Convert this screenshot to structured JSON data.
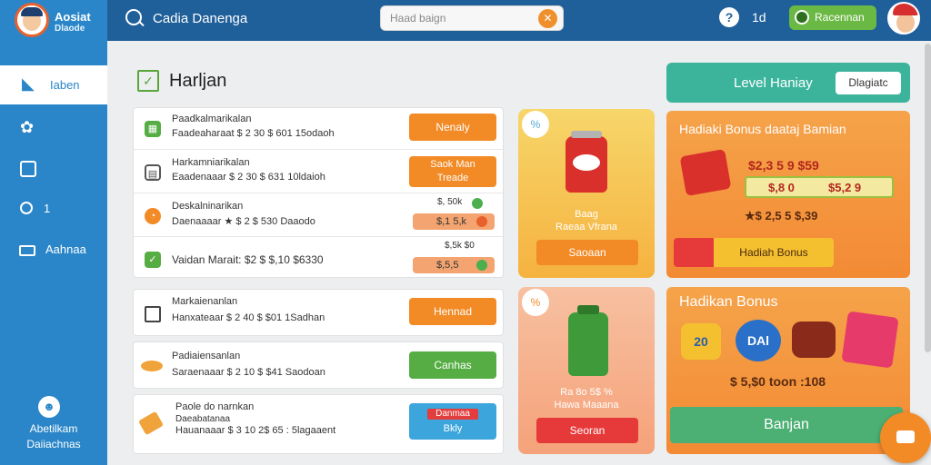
{
  "logo": {
    "line1": "Aosiat",
    "line2": "Dlaode"
  },
  "topbar": {
    "title": "Cadia Danenga",
    "search_placeholder": "Haad baign",
    "help_label": "?",
    "count": "1d",
    "redeem_label": "Racennan"
  },
  "sidebar": {
    "items": [
      {
        "label": "Iaben",
        "icon": "megaphone-icon"
      },
      {
        "label": "",
        "icon": "gear-icon"
      },
      {
        "label": "",
        "icon": "bookmark-icon"
      },
      {
        "label": "1",
        "icon": "search-icon"
      },
      {
        "label": "Aahnaa",
        "icon": "mail-icon"
      }
    ],
    "footer": {
      "icon": "person-icon",
      "line1": "Abetilkam",
      "line2": "Daiiachnas"
    }
  },
  "main": {
    "title": "Harljan",
    "tasks_group1": [
      {
        "icon": "calendar-icon",
        "title": "Paadkalmarikalan",
        "sub": "Faadeaharaat $ 2 30 $ 601 15odaoh",
        "button": "Nenaly",
        "button_color": "#f28a25"
      },
      {
        "icon": "calendar-icon",
        "title": "Harkamniarikalan",
        "sub": "Eaadenaaar $ 2 30 $ 631 10ldaioh",
        "button": "Saok Man Treade",
        "button_color": "#f28a25"
      },
      {
        "icon": "clock-icon",
        "title": "Deskalninarikan",
        "sub": "Daenaaaar ★ $ 2 $ 530 Daaodo",
        "pill_top": "$, 50k",
        "pill": "$,1 5,k",
        "pill_dot_color": "#e8612c"
      },
      {
        "icon": "check-icon",
        "title": "",
        "sub": "Vaidan Marait: $2 $ $,10 $6330",
        "pill_top": "$,5k $0",
        "pill": "$,5,5",
        "pill_dot_color": "#4cae4c"
      }
    ],
    "tasks_group2": [
      {
        "icon": "checkbox-icon",
        "title": "Markaienanlan",
        "sub": "Hanxateaar $ 2 40 $ $01 1Sadhan",
        "button": "Hennad",
        "button_color": "#f28a25"
      },
      {
        "icon": "coin-icon",
        "title": "Padiaiensanlan",
        "sub": "Saraenaaar $ 2 10 $ $41 Saodoan",
        "button": "Canhas",
        "button_color": "#56ad43"
      },
      {
        "icon": "ticket-icon",
        "title": "Paole do narnkan",
        "sub2": "Daeabatanaa",
        "sub": "Hauanaaar $ 3 10 2$ 65 : 5lagaaent",
        "button": "Danmaa",
        "button2": "Bkly",
        "button_color": "#3ba5dc"
      }
    ]
  },
  "products": [
    {
      "caption1": "Baag",
      "caption2": "Raeaa Vfrana",
      "button": "Saoaan",
      "tag": "%"
    },
    {
      "caption1": "Ra 8o 5$ %",
      "caption2": "Hawa Maaana",
      "button": "Seoran",
      "tag": "%"
    }
  ],
  "level": {
    "title": "Level Haniay",
    "button": "Dlagiatc"
  },
  "bonus1": {
    "title": "Hadiaki Bonus daataj Bamian",
    "price_a": "$2,3 5 9 $59",
    "price_b": "$,8 0",
    "price_c": "$5,2 9",
    "price_d": "★$ 2,5 5 $,39",
    "button": "Hadiah Bonus"
  },
  "bonus2": {
    "title": "Hadikan Bonus",
    "badge1": "20",
    "badge2": "DAl",
    "footer_text": "$ 5,$0 toon :108",
    "button": "Banjan"
  },
  "colors": {
    "primary": "#2a86c8",
    "topbar": "#1f5f9a",
    "orange": "#f28a25",
    "green": "#56ad43",
    "teal": "#3cb49c"
  }
}
